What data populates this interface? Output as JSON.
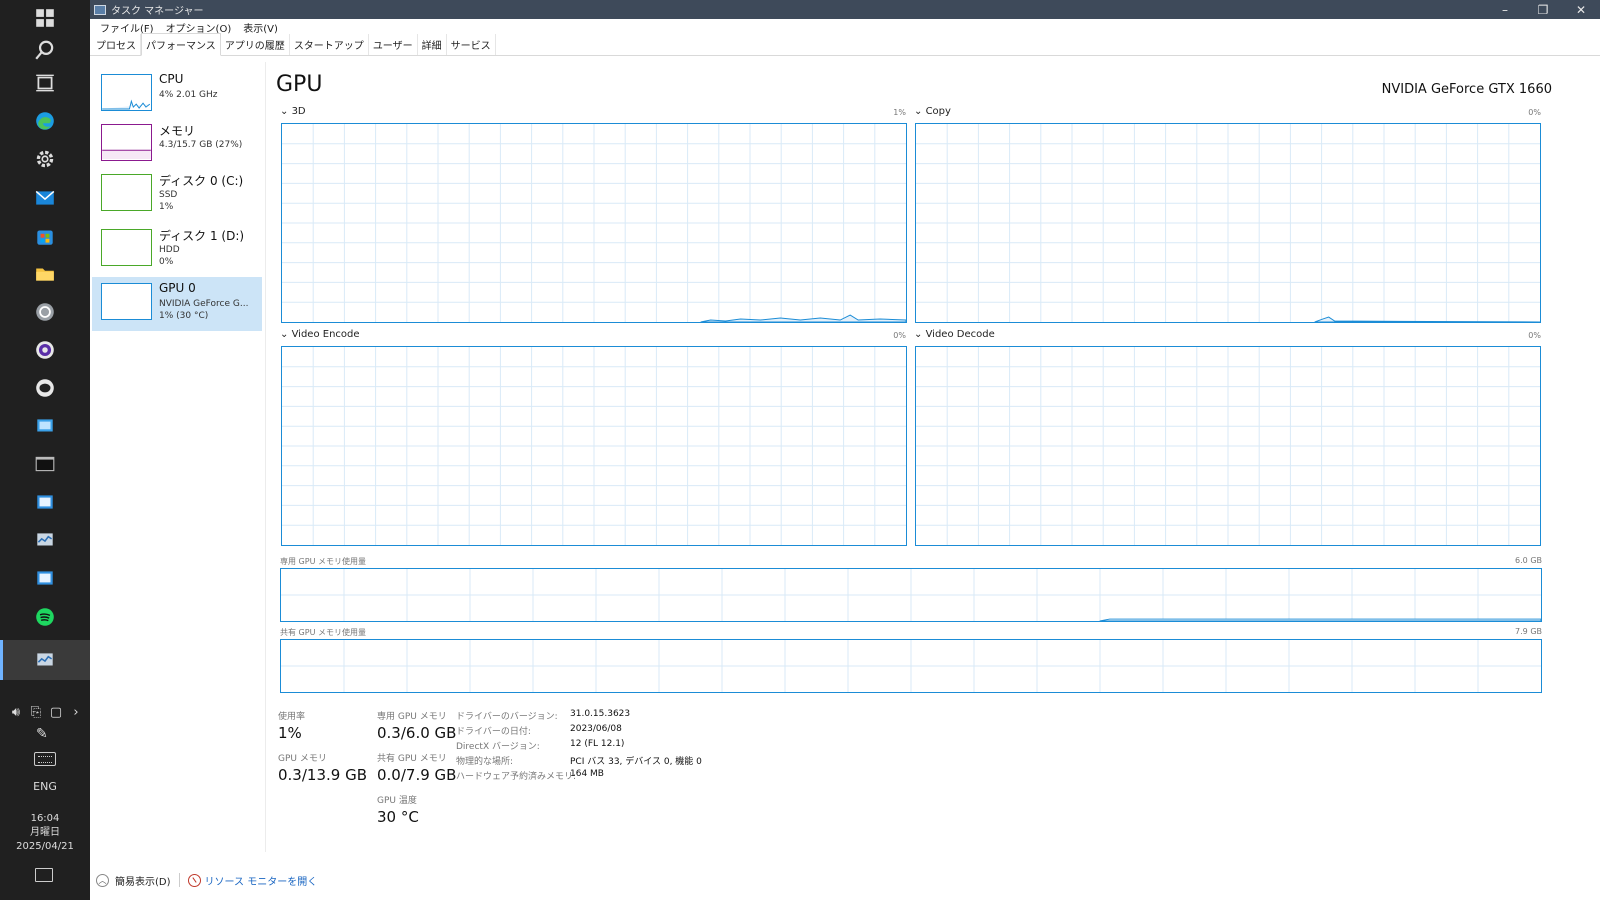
{
  "window": {
    "title": "タスク マネージャー",
    "controls": {
      "minimize": "–",
      "restore": "❐",
      "close": "✕"
    }
  },
  "menu": [
    "ファイル(F)",
    "オプション(O)",
    "表示(V)"
  ],
  "tabs": [
    {
      "label": "プロセス",
      "active": false
    },
    {
      "label": "パフォーマンス",
      "active": true
    },
    {
      "label": "アプリの履歴",
      "active": false
    },
    {
      "label": "スタートアップ",
      "active": false
    },
    {
      "label": "ユーザー",
      "active": false
    },
    {
      "label": "詳細",
      "active": false
    },
    {
      "label": "サービス",
      "active": false
    }
  ],
  "sidebar": {
    "items": [
      {
        "title": "CPU",
        "line1": "4% 2.01 GHz",
        "line2": "",
        "color": "#1b8cd6"
      },
      {
        "title": "メモリ",
        "line1": "4.3/15.7 GB (27%)",
        "line2": "",
        "color": "#8b1a8f"
      },
      {
        "title": "ディスク 0 (C:)",
        "line1": "SSD",
        "line2": "1%",
        "color": "#4aa829"
      },
      {
        "title": "ディスク 1 (D:)",
        "line1": "HDD",
        "line2": "0%",
        "color": "#4aa829"
      },
      {
        "title": "GPU 0",
        "line1": "NVIDIA GeForce G...",
        "line2": "1% (30 °C)",
        "color": "#1b8cd6",
        "selected": true
      }
    ]
  },
  "gpu": {
    "title": "GPU",
    "model": "NVIDIA GeForce GTX 1660",
    "engines": [
      {
        "name": "3D",
        "percent": "1%"
      },
      {
        "name": "Copy",
        "percent": "0%"
      },
      {
        "name": "Video Encode",
        "percent": "0%"
      },
      {
        "name": "Video Decode",
        "percent": "0%"
      }
    ],
    "dedicated_mem": {
      "label": "専用 GPU メモリ使用量",
      "max": "6.0 GB"
    },
    "shared_mem": {
      "label": "共有 GPU メモリ使用量",
      "max": "7.9 GB"
    }
  },
  "stats": {
    "utilization": {
      "label": "使用率",
      "value": "1%"
    },
    "gpu_memory": {
      "label": "GPU メモリ",
      "value": "0.3/13.9 GB"
    },
    "dedicated": {
      "label": "専用 GPU メモリ",
      "value": "0.3/6.0 GB"
    },
    "shared": {
      "label": "共有 GPU メモリ",
      "value": "0.0/7.9 GB"
    },
    "temperature": {
      "label": "GPU 温度",
      "value": "30 °C"
    }
  },
  "info": [
    {
      "key": "ドライバーのバージョン:",
      "value": "31.0.15.3623"
    },
    {
      "key": "ドライバーの日付:",
      "value": "2023/06/08"
    },
    {
      "key": "DirectX バージョン:",
      "value": "12 (FL 12.1)"
    },
    {
      "key": "物理的な場所:",
      "value": "PCI バス 33, デバイス 0, 機能 0"
    },
    {
      "key": "ハードウェア予約済みメモリ:",
      "value": "164 MB"
    }
  ],
  "footer": {
    "fewer_details": "簡易表示(D)",
    "resource_monitor": "リソース モニターを開く"
  },
  "taskbar": {
    "lang": "ENG",
    "time": "16:04",
    "day": "月曜日",
    "date": "2025/04/21",
    "apps": [
      "start-icon",
      "search-icon",
      "task-view-icon",
      "edge-icon",
      "settings-icon",
      "mail-icon",
      "store-icon",
      "file-explorer-icon",
      "chatgpt-icon",
      "obs-icon",
      "line-icon",
      "remote-desktop-icon",
      "terminal-icon",
      "app-window-icon",
      "task-manager-icon",
      "app-window-icon",
      "spotify-icon",
      "task-manager-icon"
    ]
  }
}
